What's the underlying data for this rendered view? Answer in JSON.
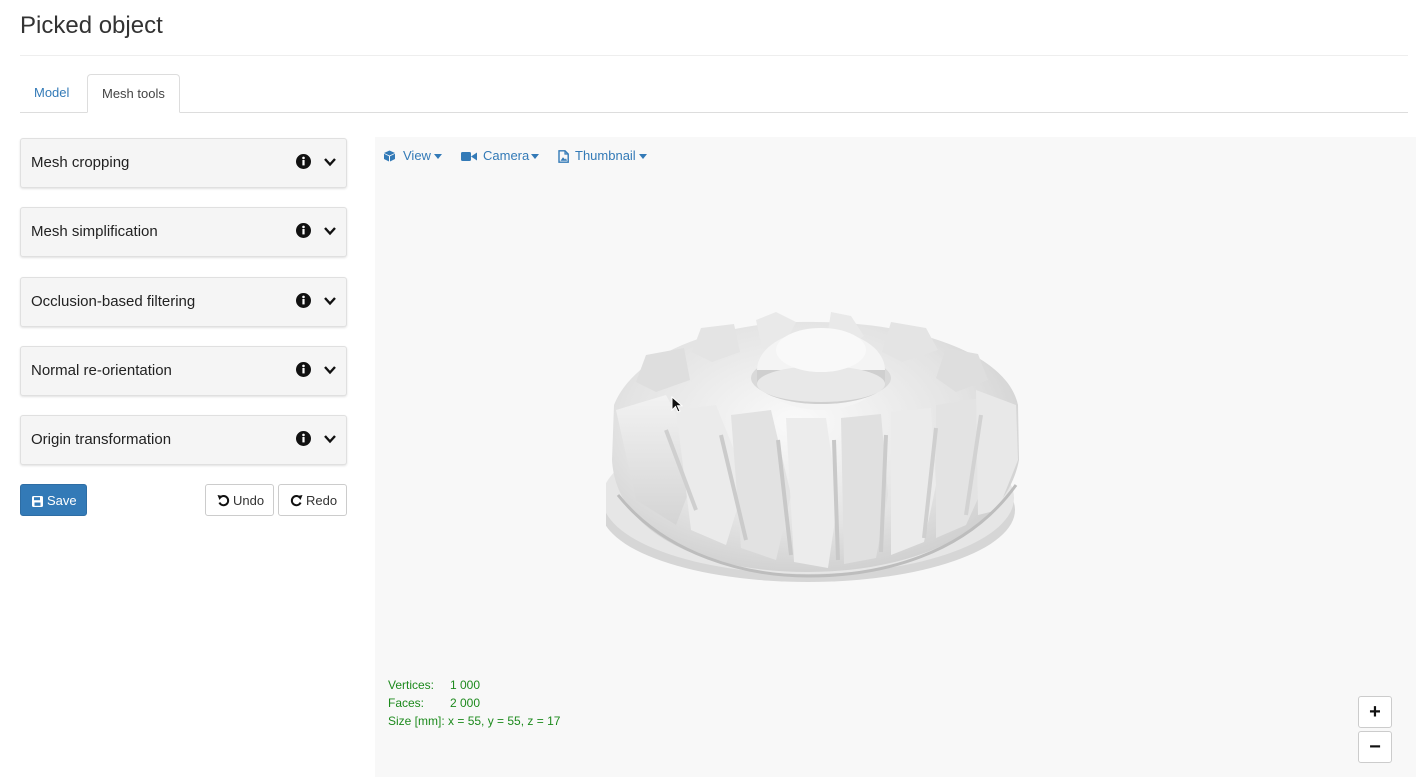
{
  "page": {
    "title": "Picked object"
  },
  "tabs": [
    {
      "label": "Model",
      "active": false
    },
    {
      "label": "Mesh tools",
      "active": true
    }
  ],
  "panels": [
    {
      "label": "Mesh cropping",
      "info_icon": "info-circle-icon",
      "toggle_icon": "chevron-down-icon"
    },
    {
      "label": "Mesh simplification",
      "info_icon": "info-circle-icon",
      "toggle_icon": "chevron-down-icon"
    },
    {
      "label": "Occlusion-based filtering",
      "info_icon": "info-circle-icon",
      "toggle_icon": "chevron-down-icon"
    },
    {
      "label": "Normal re-orientation",
      "info_icon": "info-circle-icon",
      "toggle_icon": "chevron-down-icon"
    },
    {
      "label": "Origin transformation",
      "info_icon": "info-circle-icon",
      "toggle_icon": "chevron-down-icon"
    }
  ],
  "actions": {
    "save": {
      "label": "Save",
      "icon": "floppy-disk-icon"
    },
    "undo": {
      "label": "Undo",
      "icon": "undo-icon"
    },
    "redo": {
      "label": "Redo",
      "icon": "redo-icon"
    }
  },
  "viewer": {
    "menus": [
      {
        "label": "View",
        "icon": "cube-icon"
      },
      {
        "label": "Camera",
        "icon": "video-camera-icon"
      },
      {
        "label": "Thumbnail",
        "icon": "image-file-icon"
      }
    ],
    "stats": {
      "vertices_label": "Vertices:",
      "vertices_value": "1 000",
      "faces_label": "Faces:",
      "faces_value": "2 000",
      "size_label": "Size [mm]:",
      "size_value": "x = 55, y = 55, z = 17"
    },
    "zoom": {
      "in_label": "+",
      "out_label": "−"
    },
    "model": "3D gear mesh"
  },
  "colors": {
    "accent": "#337ab7",
    "stats_text": "#1d8a1d",
    "viewer_bg": "#f8f8f8",
    "panel_bg": "#f5f5f5"
  }
}
